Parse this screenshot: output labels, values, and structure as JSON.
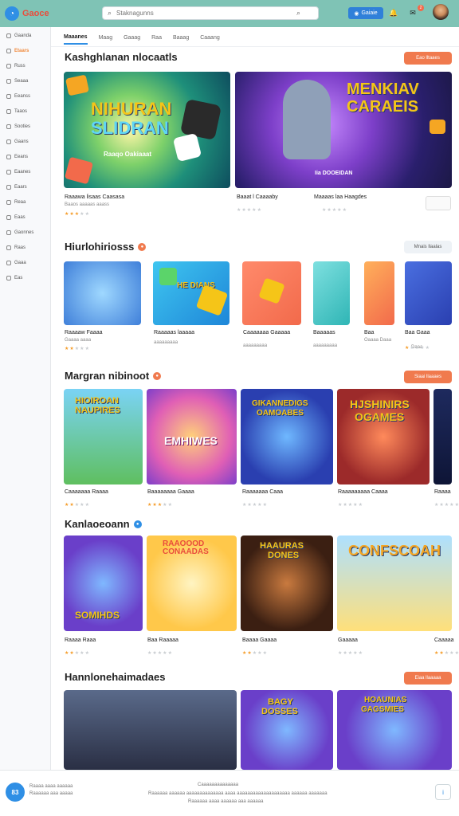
{
  "app": {
    "logo_text": "Gaoce"
  },
  "search": {
    "placeholder": "Staknagunns"
  },
  "topbar": {
    "button_label": "Gaiaie",
    "badge_count": "2"
  },
  "sidebar": {
    "items": [
      {
        "label": "Gaanda",
        "active": false
      },
      {
        "label": "Etaars",
        "active": true
      },
      {
        "label": "Russ",
        "active": false
      },
      {
        "label": "Seaaa",
        "active": false
      },
      {
        "label": "Eeanss",
        "active": false
      },
      {
        "label": "Taaos",
        "active": false
      },
      {
        "label": "Sooties",
        "active": false
      },
      {
        "label": "Gaans",
        "active": false
      },
      {
        "label": "Eeans",
        "active": false
      },
      {
        "label": "Eaanes",
        "active": false
      },
      {
        "label": "Eaars",
        "active": false
      },
      {
        "label": "Reaa",
        "active": false
      },
      {
        "label": "Eaas",
        "active": false
      },
      {
        "label": "Gaonnes",
        "active": false
      },
      {
        "label": "Raas",
        "active": false
      },
      {
        "label": "Gaaa",
        "active": false
      },
      {
        "label": "Eas",
        "active": false
      }
    ]
  },
  "tabs": [
    "Maaanes",
    "Maag",
    "Gaaag",
    "Raa",
    "Baaag",
    "Caaang"
  ],
  "sections": {
    "s1": {
      "title": "Kashghlanan nlocaatls",
      "button": "Eao lltaaes",
      "cards": [
        {
          "title": "Raaawa lisaas Caasasa",
          "sub": "Baaos aaaaas aaass",
          "banner": [
            "NIHURAN",
            "SLIDRAN"
          ],
          "caption": "Raaqo Oakiaaat",
          "stars": 3
        },
        {
          "title": "Baaat l Caaaaby",
          "sub": "",
          "banner": [
            "MENKIAV",
            "CARAEIS"
          ],
          "caption": "Iia DOOEIDAN",
          "stars": 0
        },
        {
          "title": "Maaaas laa Haagdes",
          "sub": "",
          "stars": 0
        }
      ]
    },
    "s2": {
      "title": "Hiurlohiriosss",
      "button": "Mnais llaalas",
      "tile_text": "HE DIANS",
      "cards": [
        {
          "title": "Raaaaw Faaaa",
          "sub": "Gaaaa aaaa",
          "stars": 2
        },
        {
          "title": "Raaaaas laaaaa",
          "sub": "aaaaaaaaa",
          "stars": 0
        },
        {
          "title": "Caaaaaaa Gaaaaa",
          "sub": "aaaaaaaaa",
          "stars": 0
        },
        {
          "title": "Baaaaas",
          "sub": "aaaaaaaaa",
          "stars": 0
        },
        {
          "title": "Baa",
          "sub": "Oaaaa Daaa",
          "stars": 0
        },
        {
          "title": "Baa Gaaa",
          "sub": "Daaa",
          "stars": 1
        }
      ]
    },
    "s3": {
      "title": "Margran nibinoot",
      "button": "Siaai llaaaes",
      "cards": [
        {
          "title": "Caaaaaaa Raaaa",
          "banner": [
            "HIOIROAN",
            "NAUPIRES"
          ],
          "stars": 2
        },
        {
          "title": "Baaaaaaaa Gaaaa",
          "banner": [
            "EMHIWES"
          ],
          "stars": 3
        },
        {
          "title": "Raaaaaaa Caaa",
          "banner": [
            "GIKANNEDIGS",
            "OAMOABES"
          ],
          "stars": 0
        },
        {
          "title": "Raaaaaaaaa Caaaa",
          "banner": [
            "HJSHINIRS",
            "OGAMES"
          ],
          "stars": 0
        },
        {
          "title": "Raaaa",
          "stars": 0
        }
      ]
    },
    "s4": {
      "title": "Kanlaoeoann",
      "cards": [
        {
          "title": "Raaaa Raaa",
          "banner": [
            "SOMIHDS"
          ],
          "stars": 2
        },
        {
          "title": "Baa Raaaaa",
          "banner": [
            "RAAOOOD",
            "CONAADAS"
          ],
          "stars": 0
        },
        {
          "title": "Baaaa Gaaaa",
          "banner": [
            "HAAURAS",
            "DONES"
          ],
          "stars": 2
        },
        {
          "title": "Gaaaaa",
          "banner": [
            "CONFSCOAH"
          ],
          "stars": 0
        },
        {
          "title": "Caaaaa",
          "stars": 2
        }
      ]
    },
    "s5": {
      "title": "Hannlonehaimadaes",
      "button": "Eiaa llaaaaa",
      "cards": [
        {
          "banner": []
        },
        {
          "banner": [
            "BAGY",
            "DOSSES"
          ]
        },
        {
          "banner": [
            "HOAUNIAS",
            "GAGSMIES"
          ]
        }
      ]
    }
  },
  "footer": {
    "fab": "83",
    "left_line1": "Raaaa aaaa aaaaaa",
    "left_line2": "Raaaaaa aaa aaaaa",
    "center_title": "Caaaaaaaaaaaaaa",
    "center_line1": "Raaaaaa aaaaaa aaaaaaaaaaaaaa aaaa aaaaaaaaaaaaaaaaaaaa aaaaaa aaaaaaa",
    "center_line2": "Raaaaaa aaaa aaaaaa aaa aaaaaa"
  },
  "colors": {
    "accent": "#2f8fe5",
    "orange": "#f07a4e",
    "star": "#f59d2a",
    "topbar": "#7fc3b5"
  }
}
